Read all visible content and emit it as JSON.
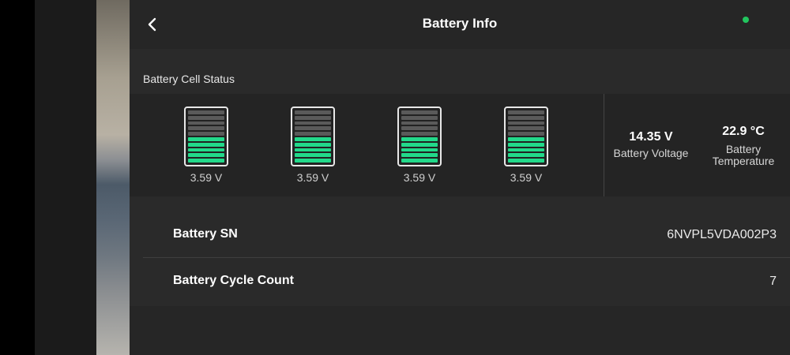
{
  "header": {
    "title": "Battery Info"
  },
  "section": {
    "cell_status_label": "Battery Cell Status"
  },
  "cells": [
    {
      "voltage": "3.59 V",
      "level": 0.5
    },
    {
      "voltage": "3.59 V",
      "level": 0.5
    },
    {
      "voltage": "3.59 V",
      "level": 0.5
    },
    {
      "voltage": "3.59 V",
      "level": 0.5
    }
  ],
  "stats": {
    "voltage": {
      "value": "14.35 V",
      "label": "Battery Voltage"
    },
    "temperature": {
      "value": "22.9 °C",
      "label_line1": "Battery",
      "label_line2": "Temperature"
    }
  },
  "info_rows": [
    {
      "name": "Battery SN",
      "value": "6NVPL5VDA002P3"
    },
    {
      "name": "Battery Cycle Count",
      "value": "7"
    }
  ],
  "colors": {
    "accent_green": "#22d98a",
    "status_dot": "#22c55e"
  },
  "icons": {
    "back": "chevron-left-icon"
  }
}
